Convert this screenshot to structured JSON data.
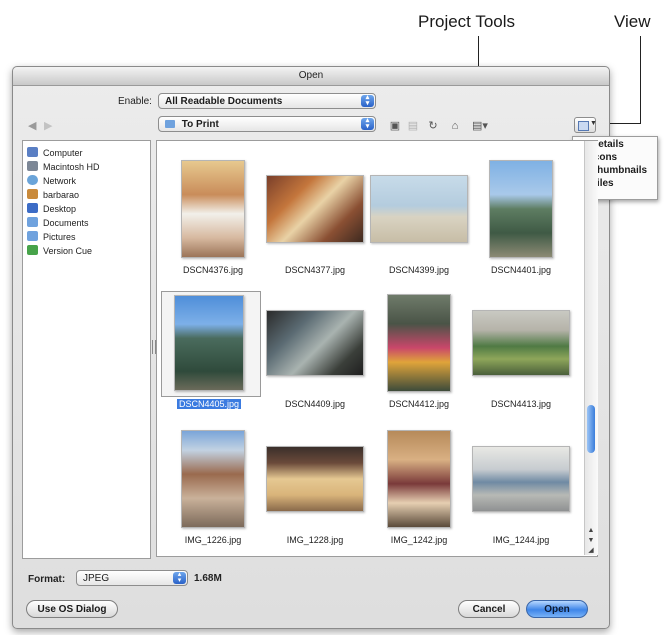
{
  "callouts": {
    "project_tools": "Project Tools",
    "view": "View"
  },
  "dialog": {
    "title": "Open",
    "enable_label": "Enable:",
    "enable_value": "All Readable Documents",
    "location_value": "To Print"
  },
  "sidebar": {
    "items": [
      {
        "label": "Computer",
        "icon": "computer-icon",
        "color": "#5a7fc4"
      },
      {
        "label": "Macintosh HD",
        "icon": "hard-drive-icon",
        "color": "#7c8796"
      },
      {
        "label": "Network",
        "icon": "network-globe-icon",
        "color": "#6aa4d9"
      },
      {
        "label": "barbarao",
        "icon": "home-icon",
        "color": "#c98a3b"
      },
      {
        "label": "Desktop",
        "icon": "desktop-icon",
        "color": "#3c6cc6"
      },
      {
        "label": "Documents",
        "icon": "folder-icon",
        "color": "#6fa2de"
      },
      {
        "label": "Pictures",
        "icon": "folder-icon",
        "color": "#6fa2de"
      },
      {
        "label": "Version Cue",
        "icon": "version-cue-icon",
        "color": "#47a34a"
      }
    ]
  },
  "files": [
    {
      "name": "DSCN4376.jpg"
    },
    {
      "name": "DSCN4377.jpg"
    },
    {
      "name": "DSCN4399.jpg"
    },
    {
      "name": "DSCN4401.jpg"
    },
    {
      "name": "DSCN4405.jpg"
    },
    {
      "name": "DSCN4409.jpg"
    },
    {
      "name": "DSCN4412.jpg"
    },
    {
      "name": "DSCN4413.jpg"
    },
    {
      "name": "IMG_1226.jpg"
    },
    {
      "name": "IMG_1228.jpg"
    },
    {
      "name": "IMG_1242.jpg"
    },
    {
      "name": "IMG_1244.jpg"
    }
  ],
  "selected_file": "DSCN4405.jpg",
  "format": {
    "label": "Format:",
    "value": "JPEG",
    "size": "1.68M"
  },
  "buttons": {
    "use_os_dialog": "Use OS Dialog",
    "cancel": "Cancel",
    "open": "Open"
  },
  "view_menu": {
    "items": [
      "Details",
      "Icons",
      "Thumbnails",
      "Tiles"
    ],
    "checked": "Thumbnails"
  },
  "colors": {
    "accent": "#3f86e8",
    "selection": "#3b7be0"
  }
}
